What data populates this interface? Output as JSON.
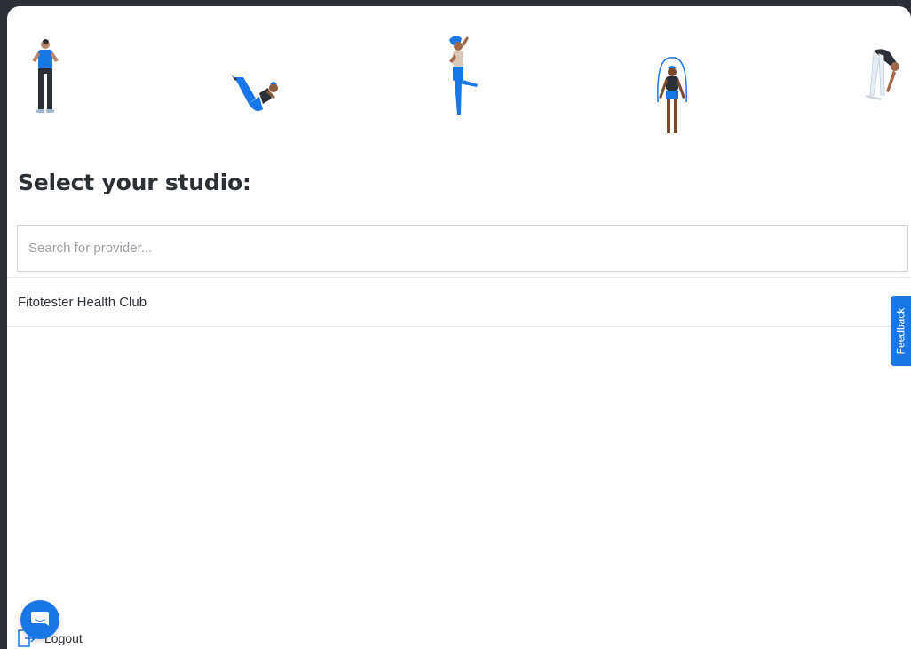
{
  "page": {
    "heading": "Select your studio:",
    "illustrations": [
      "standing-athlete-icon",
      "pilates-v-sit-icon",
      "balance-pose-icon",
      "jump-rope-icon",
      "forward-bend-icon"
    ]
  },
  "search": {
    "placeholder": "Search for provider...",
    "value": ""
  },
  "providers": [
    {
      "name": "Fitotester Health Club"
    }
  ],
  "feedback": {
    "label": "Feedback"
  },
  "footer": {
    "logout_label": "Logout"
  },
  "colors": {
    "accent": "#1976e6",
    "background": "#2b2f36",
    "text": "#2b2f36"
  }
}
